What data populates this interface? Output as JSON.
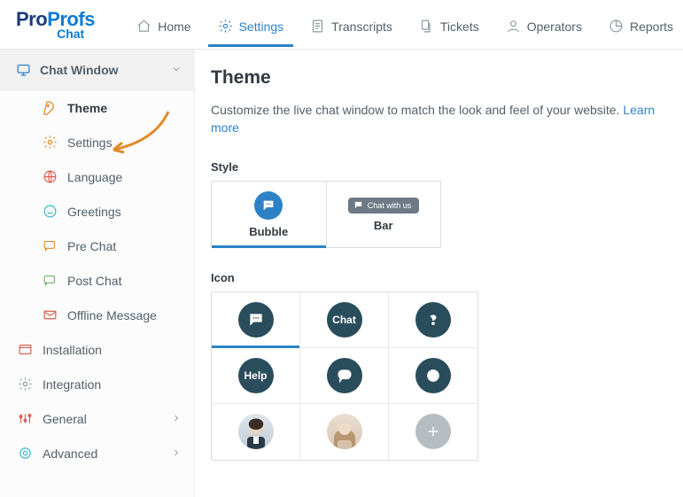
{
  "brand": {
    "pro": "Pro",
    "profs": "Profs",
    "chat": "Chat"
  },
  "nav": {
    "items": [
      {
        "label": "Home",
        "active": false
      },
      {
        "label": "Settings",
        "active": true
      },
      {
        "label": "Transcripts",
        "active": false
      },
      {
        "label": "Tickets",
        "active": false
      },
      {
        "label": "Operators",
        "active": false
      },
      {
        "label": "Reports",
        "active": false
      }
    ]
  },
  "sidebar": {
    "accordion_label": "Chat Window",
    "subitems": [
      {
        "label": "Theme",
        "active": true
      },
      {
        "label": "Settings"
      },
      {
        "label": "Language"
      },
      {
        "label": "Greetings"
      },
      {
        "label": "Pre Chat"
      },
      {
        "label": "Post Chat"
      },
      {
        "label": "Offline Message"
      }
    ],
    "sections": [
      {
        "label": "Installation",
        "expandable": false
      },
      {
        "label": "Integration",
        "expandable": false
      },
      {
        "label": "General",
        "expandable": true
      },
      {
        "label": "Advanced",
        "expandable": true
      }
    ]
  },
  "page": {
    "title": "Theme",
    "description": "Customize the live chat window to match the look and feel of your website. ",
    "learn_more": "Learn more"
  },
  "style": {
    "section_label": "Style",
    "options": [
      {
        "label": "Bubble",
        "selected": true
      },
      {
        "label": "Bar",
        "selected": false
      }
    ],
    "bar_preview_text": "Chat with us"
  },
  "icon": {
    "section_label": "Icon",
    "items": [
      {
        "kind": "speech",
        "selected": true
      },
      {
        "kind": "text",
        "label": "Chat"
      },
      {
        "kind": "question"
      },
      {
        "kind": "text",
        "label": "Help"
      },
      {
        "kind": "speech-outline"
      },
      {
        "kind": "ring"
      },
      {
        "kind": "avatar-m"
      },
      {
        "kind": "avatar-f"
      },
      {
        "kind": "add"
      }
    ]
  },
  "colors": {
    "accent": "#2d82c7",
    "icon_bg": "#2a4d5c"
  }
}
